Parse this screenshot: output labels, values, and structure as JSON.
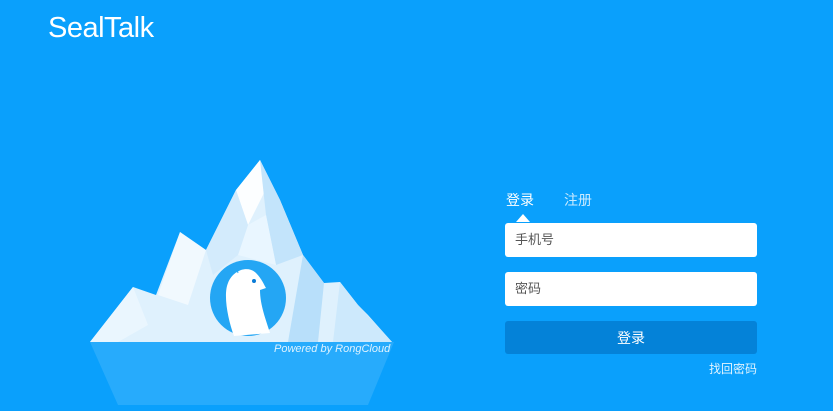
{
  "header": {
    "logo_text": "SealTalk"
  },
  "illustration": {
    "name": "iceberg-seal-illustration",
    "credit": "Powered by RongCloud"
  },
  "login_form": {
    "tabs": [
      {
        "label": "登录",
        "active": true
      },
      {
        "label": "注册",
        "active": false
      }
    ],
    "phone_placeholder": "手机号",
    "phone_value": "",
    "password_placeholder": "密码",
    "password_value": "",
    "submit_label": "登录",
    "forgot_link": "找回密码"
  },
  "colors": {
    "background": "#0aa0fc",
    "button": "#0482d8",
    "input_bg": "#ffffff"
  }
}
